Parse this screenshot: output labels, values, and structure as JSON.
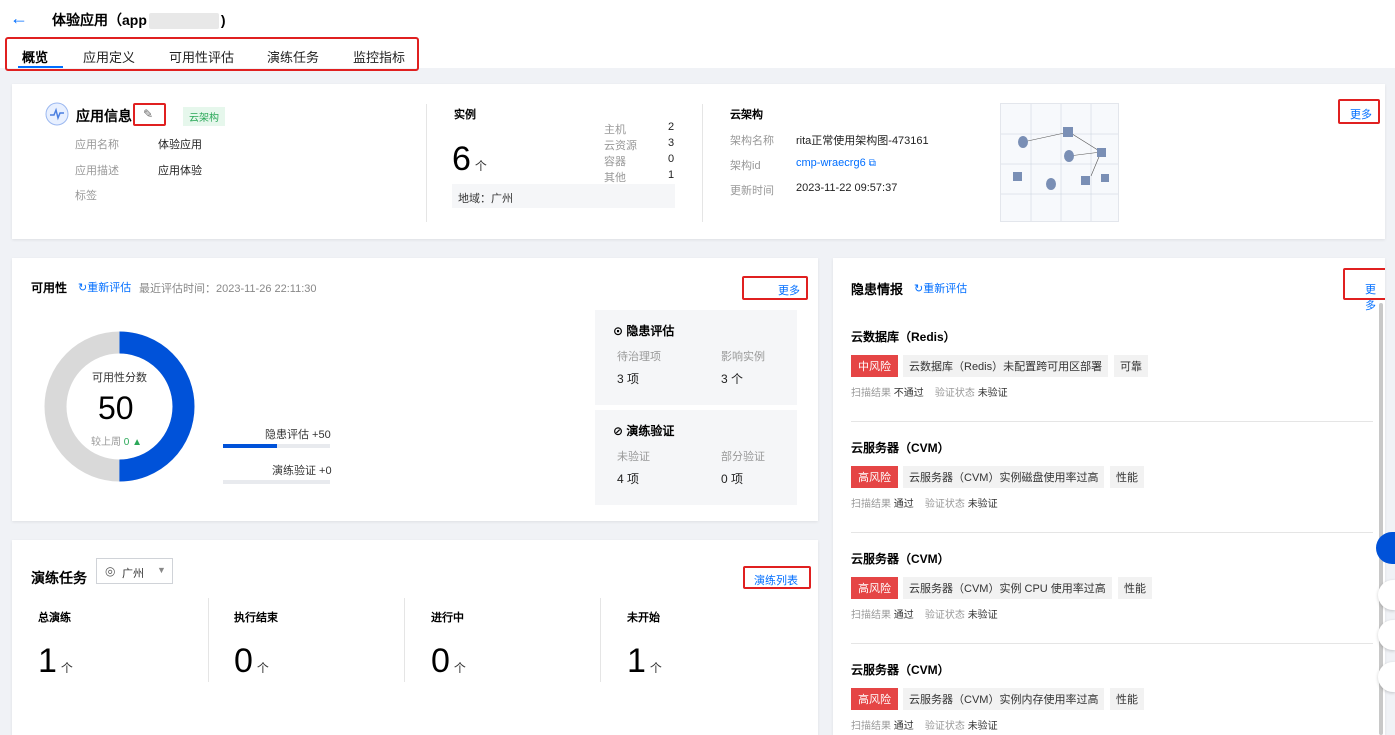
{
  "header": {
    "back_icon": "←",
    "title_prefix": "体验应用（app",
    "title_suffix": ")"
  },
  "tabs": [
    "概览",
    "应用定义",
    "可用性评估",
    "演练任务",
    "监控指标"
  ],
  "app_info": {
    "title": "应用信息",
    "tag": "云架构",
    "name_label": "应用名称",
    "name_value": "体验应用",
    "desc_label": "应用描述",
    "desc_value": "应用体验",
    "tags_label": "标签"
  },
  "instances": {
    "title": "实例",
    "count": "6",
    "unit": "个",
    "region": "地域：广州",
    "items": [
      {
        "label": "主机",
        "value": "2"
      },
      {
        "label": "云资源",
        "value": "3"
      },
      {
        "label": "容器",
        "value": "0"
      },
      {
        "label": "其他",
        "value": "1"
      }
    ]
  },
  "architecture": {
    "title": "云架构",
    "name_label": "架构名称",
    "name_value": "rita正常使用架构图-473161",
    "id_label": "架构id",
    "id_value": "cmp-wraecrg6",
    "time_label": "更新时间",
    "time_value": "2023-11-22 09:57:37",
    "more": "更多"
  },
  "availability": {
    "title": "可用性",
    "reassess": "重新评估",
    "last_time": "最近评估时间：2023-11-26 22:11:30",
    "more": "更多",
    "score_label": "可用性分数",
    "score": "50",
    "score_fraction": 0.5,
    "week_label": "较上周",
    "week_value": "0",
    "bar1_label": "隐患评估 +50",
    "bar1_fraction": 0.5,
    "bar2_label": "演练验证 +0",
    "bar2_fraction": 0,
    "risk_box": {
      "title": "隐患评估",
      "c1_label": "待治理项",
      "c1_value": "3",
      "c1_unit": "项",
      "c2_label": "影响实例",
      "c2_value": "3",
      "c2_unit": "个"
    },
    "drill_box": {
      "title": "演练验证",
      "c1_label": "未验证",
      "c1_value": "4",
      "c1_unit": "项",
      "c2_label": "部分验证",
      "c2_value": "0",
      "c2_unit": "项"
    },
    "colors": {
      "accent": "#0052d9",
      "ring_bg": "#d9d9d9"
    }
  },
  "drill_tasks": {
    "title": "演练任务",
    "region": "广州",
    "list_link": "演练列表",
    "stats": [
      {
        "label": "总演练",
        "value": "1",
        "unit": "个"
      },
      {
        "label": "执行结束",
        "value": "0",
        "unit": "个"
      },
      {
        "label": "进行中",
        "value": "0",
        "unit": "个"
      },
      {
        "label": "未开始",
        "value": "1",
        "unit": "个"
      }
    ]
  },
  "hazards": {
    "title": "隐患情报",
    "reassess": "重新评估",
    "more": "更多",
    "scan_label": "扫描结果",
    "verify_label": "验证状态",
    "items": [
      {
        "name": "云数据库（Redis）",
        "risk": "中风险",
        "risk_color": "#e54545",
        "desc": "云数据库（Redis）未配置跨可用区部署",
        "category": "可靠",
        "scan": "不通过",
        "verify": "未验证"
      },
      {
        "name": "云服务器（CVM）",
        "risk": "高风险",
        "risk_color": "#e54545",
        "desc": "云服务器（CVM）实例磁盘使用率过高",
        "category": "性能",
        "scan": "通过",
        "verify": "未验证"
      },
      {
        "name": "云服务器（CVM）",
        "risk": "高风险",
        "risk_color": "#e54545",
        "desc": "云服务器（CVM）实例 CPU 使用率过高",
        "category": "性能",
        "scan": "通过",
        "verify": "未验证"
      },
      {
        "name": "云服务器（CVM）",
        "risk": "高风险",
        "risk_color": "#e54545",
        "desc": "云服务器（CVM）实例内存使用率过高",
        "category": "性能",
        "scan": "通过",
        "verify": "未验证"
      }
    ]
  }
}
